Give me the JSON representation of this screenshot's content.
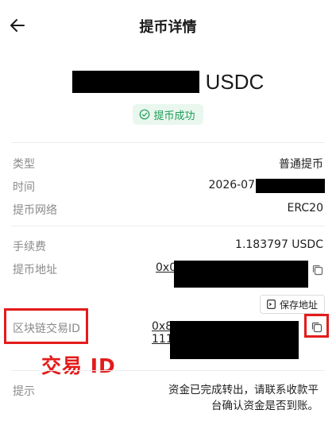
{
  "header": {
    "title": "提币详情"
  },
  "amount": {
    "unit": "USDC"
  },
  "status": {
    "label": "提币成功"
  },
  "details": {
    "type_label": "类型",
    "type_value": "普通提币",
    "time_label": "时间",
    "time_value": "2026-07",
    "network_label": "提币网络",
    "network_value": "ERC20",
    "fee_label": "手续费",
    "fee_value": "1.183797 USDC",
    "address_label": "提币地址",
    "address_prefix": "0x0",
    "save_address": "保存地址",
    "txid_label": "区块链交易ID",
    "txid_line1": "0x8",
    "txid_line2": "111",
    "tip_label": "提示",
    "tip_value": "资金已完成转出，请联系收款平台确认资金是否到账。"
  },
  "annotation": {
    "text": "交易 ID",
    "color": "#e31b1b"
  },
  "colors": {
    "success": "#1f9d55",
    "success_bg": "#e9f7ef",
    "label": "#8a8a8a"
  }
}
